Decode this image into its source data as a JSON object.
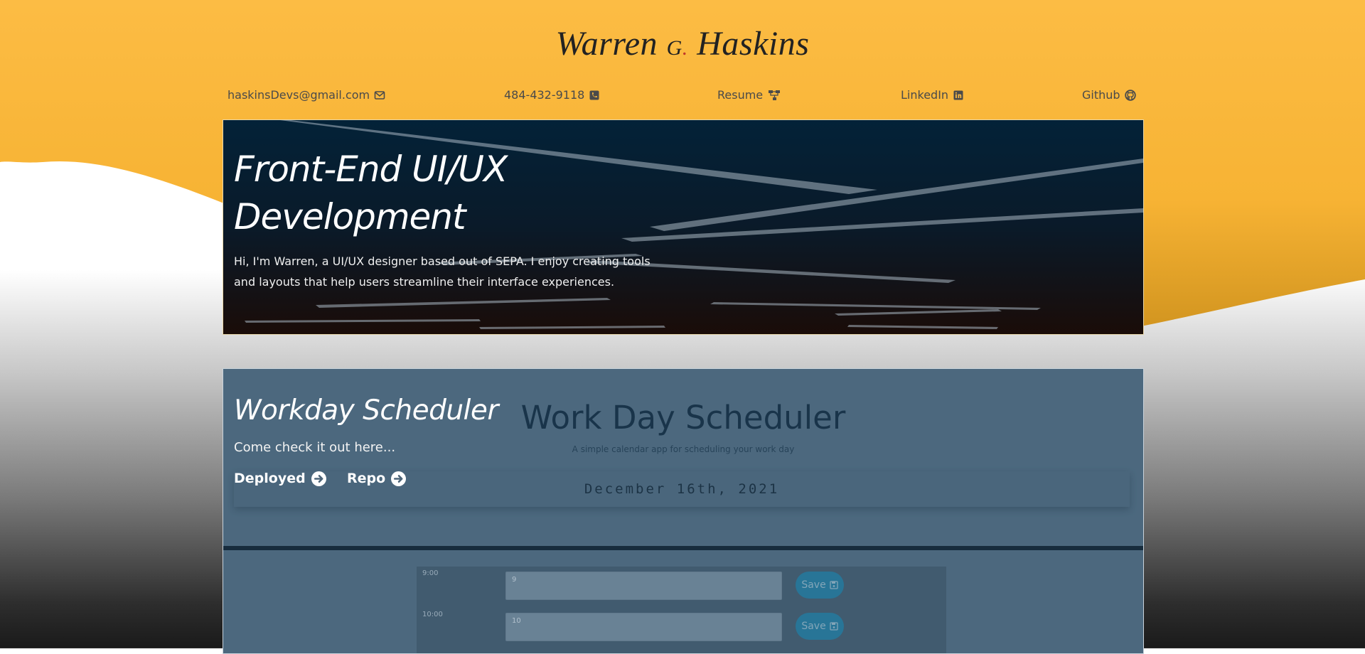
{
  "header": {
    "name_first": "Warren",
    "name_middle": "G",
    "name_dot": ".",
    "name_last": "Haskins",
    "contacts": [
      {
        "label": "haskinsDevs@gmail.com",
        "icon": "envelope-icon"
      },
      {
        "label": "484-432-9118",
        "icon": "phone-icon"
      },
      {
        "label": "Resume",
        "icon": "sitemap-icon"
      },
      {
        "label": "LinkedIn",
        "icon": "linkedin-icon"
      },
      {
        "label": "Github",
        "icon": "github-icon"
      }
    ]
  },
  "hero": {
    "title_line1": "Front-End UI/UX",
    "title_line2": "Development",
    "desc_line1": "Hi, I'm Warren, a UI/UX designer based out of SEPA. I enjoy creating tools",
    "desc_line2": "and layouts that help users streamline their interface experiences."
  },
  "project": {
    "title": "Workday Scheduler",
    "desc": "Come check it out here...",
    "deployed_label": "Deployed",
    "repo_label": "Repo",
    "preview": {
      "title": "Work Day Scheduler",
      "subtitle": "A simple calendar app for scheduling your work day",
      "date": "December 16th, 2021",
      "rows": [
        {
          "hour": "9:00",
          "value": "9",
          "save": "Save"
        },
        {
          "hour": "10:00",
          "value": "10",
          "save": "Save"
        }
      ]
    }
  },
  "colors": {
    "accent_yellow": "#fbbb42",
    "dark_navy": "#032238",
    "save_blue": "#2c86a8"
  }
}
